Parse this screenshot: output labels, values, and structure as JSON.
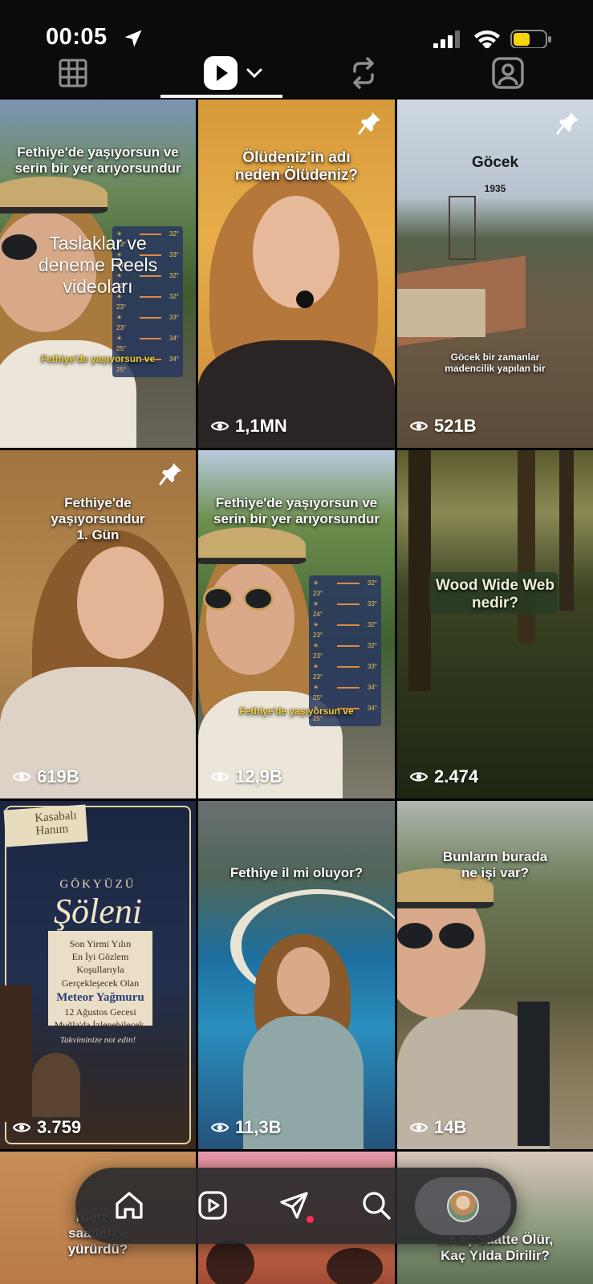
{
  "status": {
    "time": "00:05"
  },
  "tabs": {
    "items": [
      "grid",
      "reels",
      "reposts",
      "tagged"
    ],
    "active": "reels"
  },
  "tiles": [
    {
      "id": 1,
      "captions": [
        "Fethiye'de yaşıyorsun ve",
        "serin bir yer arıyorsundur"
      ],
      "overlay": "Taslaklar ve deneme Reels videoları",
      "subtitle": "Fethiye'de yaşıyorsun ve",
      "views": "",
      "pinned": false
    },
    {
      "id": 2,
      "captions": [
        "Ölüdeniz'in adı",
        "neden Ölüdeniz?"
      ],
      "views": "1,1MN",
      "pinned": true
    },
    {
      "id": 3,
      "captions": [
        "Göcek",
        "1935"
      ],
      "subtitle": [
        "Göcek bir zamanlar",
        "madencilik yapılan bir"
      ],
      "views": "521B",
      "pinned": true
    },
    {
      "id": 4,
      "captions": [
        "Fethiye'de",
        "yaşıyorsundur",
        "1. Gün"
      ],
      "views": "619B",
      "pinned": true
    },
    {
      "id": 5,
      "captions": [
        "Fethiye'de yaşıyorsun ve",
        "serin bir yer arıyorsundur"
      ],
      "subtitle": "Fethiye'de yaşıyorsun ve",
      "views": "12,9B",
      "pinned": false
    },
    {
      "id": 6,
      "captions": [
        "Wood Wide Web",
        "nedir?"
      ],
      "views": "2.474",
      "pinned": false
    },
    {
      "id": 7,
      "poster": {
        "badge": [
          "Kasabalı",
          "Hanım"
        ],
        "heading": "GÖKYÜZÜ",
        "title": "Şöleni",
        "note": [
          "Son Yirmi Yılın",
          "En İyi Gözlem Koşullarıyla",
          "Gerçekleşecek Olan"
        ],
        "meteor": "Meteor Yağmuru",
        "note2": [
          "12 Ağustos Gecesi",
          "Muğla'da İzlenebilecek."
        ],
        "footer": "Takviminize not edin!"
      },
      "views": "3.759",
      "pinned": false
    },
    {
      "id": 8,
      "captions": [
        "Fethiye il mi oluyor?"
      ],
      "views": "11,3B",
      "pinned": false
    },
    {
      "id": 9,
      "captions": [
        "Bunların burada",
        "ne işi var?"
      ],
      "views": "14B",
      "pinned": false
    },
    {
      "id": 10,
      "captions": [
        "Nietz...",
        "saatlerce",
        "yürürdü?"
      ]
    },
    {
      "id": 11,
      "captions": []
    },
    {
      "id": 12,
      "captions": [
        "...Kaç Saatte Ölür,",
        "Kaç Yılda Dirilir?"
      ]
    }
  ],
  "colors": {
    "accent_dot": "#ff2d55",
    "battery": "#f5d20a",
    "caption_yellow": "#f2d23c"
  },
  "bottom_nav": {
    "items": [
      "home-icon",
      "reels-icon",
      "send-icon",
      "search-icon",
      "profile-avatar"
    ]
  }
}
